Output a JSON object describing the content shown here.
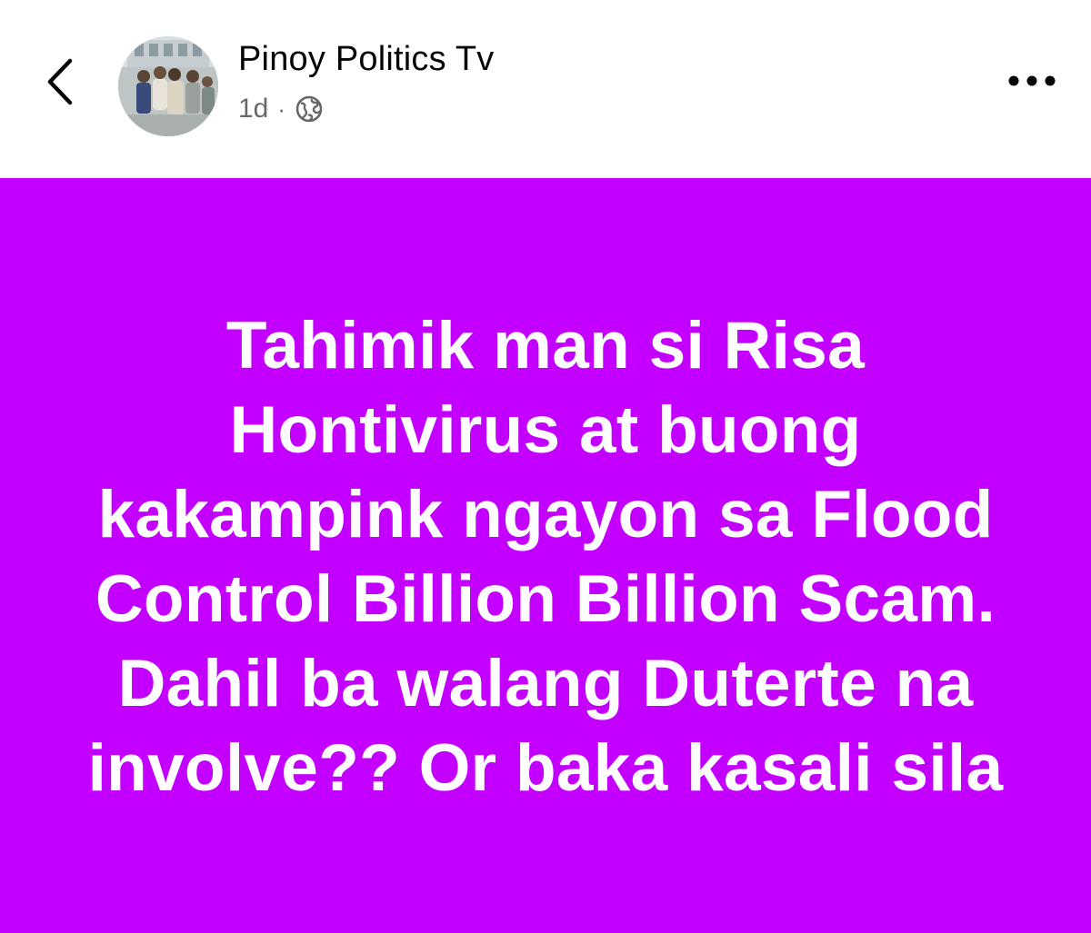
{
  "header": {
    "author_name": "Pinoy Politics Tv",
    "timestamp": "1d",
    "separator": "·",
    "audience_icon": "globe-icon",
    "back_icon": "chevron-left-icon",
    "more_icon": "more-horizontal-icon"
  },
  "post": {
    "background_color": "#c300ff",
    "text_color": "#ffffff",
    "lines": [
      "Tahimik man si Risa",
      "Hontivirus at buong",
      "kakampink ngayon sa Flood",
      "Control Billion Billion Scam.",
      "Dahil ba walang Duterte na",
      "involve?? Or baka kasali sila"
    ]
  }
}
